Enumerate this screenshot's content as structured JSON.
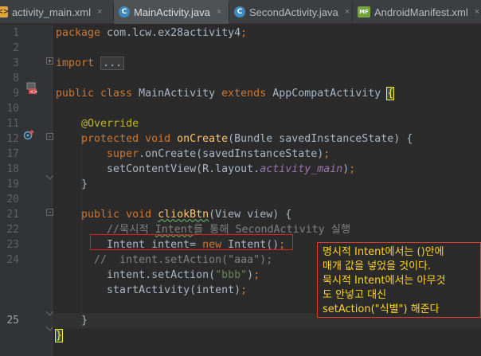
{
  "tabs": [
    {
      "label": "activity_main.xml",
      "icon": "xml-file-icon",
      "active": false
    },
    {
      "label": "MainActivity.java",
      "icon": "java-class-icon",
      "active": true
    },
    {
      "label": "SecondActivity.java",
      "icon": "java-class-icon",
      "active": false
    },
    {
      "label": "AndroidManifest.xml",
      "icon": "manifest-file-icon",
      "active": false
    }
  ],
  "tab_close_glyph": "×",
  "file_badges": {
    "java": "C",
    "xml": "<>",
    "manifest": "MF"
  },
  "line_numbers": [
    "1",
    "2",
    "3",
    "8",
    "9",
    "10",
    "11",
    "12",
    "17",
    "18",
    "19",
    "20",
    "21",
    "22",
    "23",
    "24",
    "25"
  ],
  "code": {
    "l1_package": "package",
    "l1_name": " com.lcw.ex28activity4",
    "l1_semi": ";",
    "l3_import": "import",
    "l3_folded": "...",
    "l9_public": "public class ",
    "l9_name": "MainActivity ",
    "l9_extends": "extends ",
    "l9_super": "AppCompatActivity ",
    "l9_brace": "{",
    "l11_annotation": "@Override",
    "l12_kw": "protected void ",
    "l12_method": "onCreate",
    "l12_rest": "(Bundle savedInstanceState) {",
    "l13_super": "super",
    "l13_rest": ".onCreate(savedInstanceState)",
    "l13_semi": ";",
    "l14_a": "setContentView(R.layout.",
    "l14_field": "activity_main",
    "l14_b": ")",
    "l14_semi": ";",
    "l15_brace": "}",
    "l17_kw": "public void ",
    "l17_method": "cliokBtn",
    "l17_rest": "(View view) {",
    "l18_c1": "//묵시적 ",
    "l18_c2": "Intent",
    "l18_c3": "를 통해 SecondActivity 실행",
    "l19_a": "Intent intent= ",
    "l19_new": "new ",
    "l19_b": "Intent()",
    "l19_semi": ";",
    "l20_comment": "//  intent.setAction(\"aaa\");",
    "l21_a": "intent.setAction(",
    "l21_str": "\"bbb\"",
    "l21_b": ")",
    "l21_semi": ";",
    "l22_a": "startActivity(intent)",
    "l22_semi": ";",
    "l24_brace": "}",
    "l25_brace": "}"
  },
  "annotation": {
    "lines": [
      "명시적 Intent에서는 ()안에",
      "매개 값을 넣었을 것이다.",
      "묵시적 Intent에서는 아무것",
      "도 안넣고 대신",
      "setAction(\"식별\") 해준다"
    ],
    "border_color": "#e23a2a",
    "text_color": "#ffd32a"
  },
  "highlight_box_color": "#e0201e",
  "gutter_icons": {
    "line9": "android-activity-icon",
    "line12": "override-method-icon"
  }
}
